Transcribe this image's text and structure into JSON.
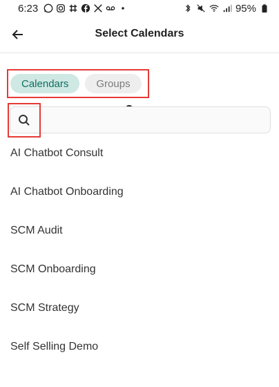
{
  "status_bar": {
    "time": "6:23",
    "battery": "95%",
    "left_icons": [
      "whatsapp-icon",
      "instagram-icon",
      "slack-icon",
      "facebook-icon",
      "x-icon",
      "voicemail-icon",
      "dot-icon"
    ],
    "right_icons": [
      "bluetooth-icon",
      "mute-icon",
      "wifi-icon",
      "signal-icon",
      "battery-icon"
    ]
  },
  "app_bar": {
    "title": "Select Calendars",
    "back_icon": "arrow-left-icon"
  },
  "segments": [
    {
      "label": "Calendars",
      "selected": true
    },
    {
      "label": "Groups",
      "selected": false
    }
  ],
  "search": {
    "value": "",
    "placeholder": ""
  },
  "calendars": [
    "AI Chatbot Consult",
    "AI Chatbot Onboarding",
    "SCM Audit",
    "SCM Onboarding",
    "SCM Strategy",
    "Self Selling Demo"
  ],
  "colors": {
    "accent": "#0d6e60",
    "accent_bg": "#cfe8e4",
    "highlight_box": "#e53935"
  }
}
